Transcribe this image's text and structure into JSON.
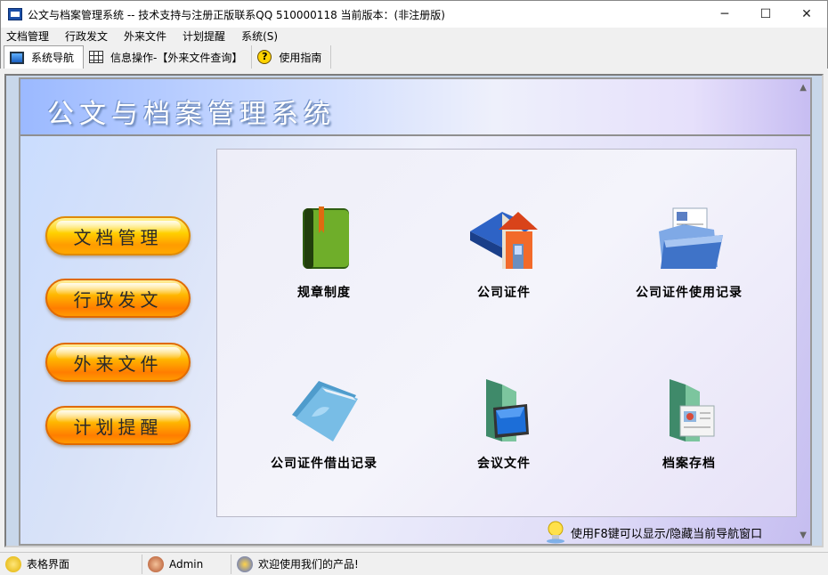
{
  "window": {
    "title": "公文与档案管理系统 -- 技术支持与注册正版联系QQ 510000118     当前版本：(非注册版)",
    "minimize": "─",
    "maximize": "☐",
    "close": "✕"
  },
  "menu": [
    "文档管理",
    "行政发文",
    "外来文件",
    "计划提醒",
    "系统(S)"
  ],
  "tabs": [
    {
      "label": "系统导航",
      "icon": "monitor-icon"
    },
    {
      "label": "信息操作-【外来文件查询】",
      "icon": "grid-icon"
    },
    {
      "label": "使用指南",
      "icon": "help-icon",
      "glyph": "?"
    }
  ],
  "banner": {
    "title": "公文与档案管理系统"
  },
  "nav_buttons": [
    "文档管理",
    "行政发文",
    "外来文件",
    "计划提醒"
  ],
  "tiles": [
    {
      "label": "规章制度",
      "icon": "book-icon"
    },
    {
      "label": "公司证件",
      "icon": "folder-house-icon"
    },
    {
      "label": "公司证件使用记录",
      "icon": "open-folder-document-icon"
    },
    {
      "label": "公司证件借出记录",
      "icon": "blue-folder-icon"
    },
    {
      "label": "会议文件",
      "icon": "folder-monitor-icon"
    },
    {
      "label": "档案存档",
      "icon": "folder-picture-icon"
    }
  ],
  "hint": "使用F8键可以显示/隐藏当前导航窗口",
  "status": {
    "view": "表格界面",
    "user": "Admin",
    "message": "欢迎使用我们的产品!"
  },
  "colors": {
    "pill_yellow": "#ffd000",
    "pill_orange": "#ff9c00",
    "banner_text": "#ffffff"
  }
}
